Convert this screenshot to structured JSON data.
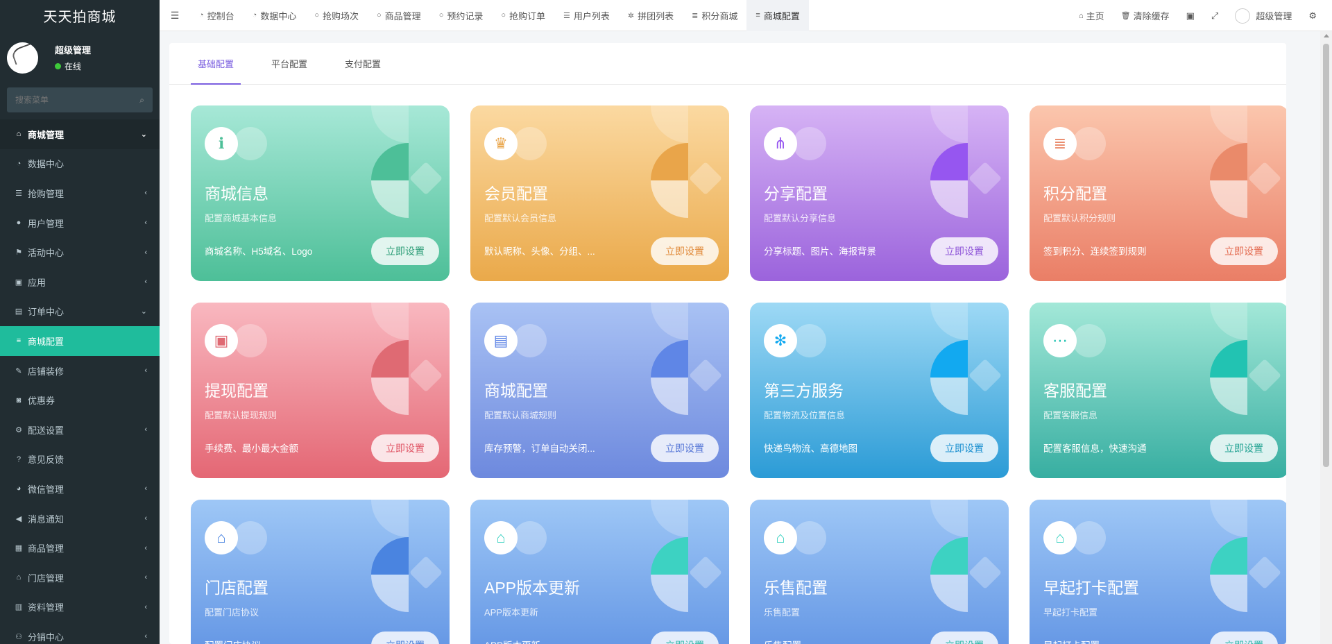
{
  "brand": "天天拍商城",
  "user": {
    "name": "超级管理",
    "status": "在线"
  },
  "search": {
    "placeholder": "搜索菜单",
    "icon": "search-icon"
  },
  "menu": [
    {
      "label": "商城管理",
      "icon": "home-icon",
      "glyph": "⌂",
      "arrow": "⌄",
      "kind": "header"
    },
    {
      "label": "数据中心",
      "icon": "dashboard-icon",
      "glyph": "◔",
      "arrow": ""
    },
    {
      "label": "抢购管理",
      "icon": "list-icon",
      "glyph": "☰",
      "arrow": "‹"
    },
    {
      "label": "用户管理",
      "icon": "user-icon",
      "glyph": "●",
      "arrow": "‹"
    },
    {
      "label": "活动中心",
      "icon": "flag-icon",
      "glyph": "⚑",
      "arrow": "‹"
    },
    {
      "label": "应用",
      "icon": "briefcase-icon",
      "glyph": "▣",
      "arrow": "‹"
    },
    {
      "label": "订单中心",
      "icon": "file-icon",
      "glyph": "▤",
      "arrow": "⌄"
    },
    {
      "label": "商城配置",
      "icon": "sliders-icon",
      "glyph": "≡",
      "arrow": "",
      "kind": "active"
    },
    {
      "label": "店铺装修",
      "icon": "brush-icon",
      "glyph": "✎",
      "arrow": "‹"
    },
    {
      "label": "优惠券",
      "icon": "ticket-icon",
      "glyph": "◙",
      "arrow": ""
    },
    {
      "label": "配送设置",
      "icon": "cogs-icon",
      "glyph": "⚙",
      "arrow": "‹"
    },
    {
      "label": "意见反馈",
      "icon": "question-icon",
      "glyph": "?",
      "arrow": ""
    },
    {
      "label": "微信管理",
      "icon": "wechat-icon",
      "glyph": "◕",
      "arrow": "‹"
    },
    {
      "label": "消息通知",
      "icon": "bullhorn-icon",
      "glyph": "◀",
      "arrow": "‹"
    },
    {
      "label": "商品管理",
      "icon": "product-icon",
      "glyph": "▦",
      "arrow": "‹"
    },
    {
      "label": "门店管理",
      "icon": "bank-icon",
      "glyph": "⌂",
      "arrow": "‹"
    },
    {
      "label": "资料管理",
      "icon": "book-icon",
      "glyph": "▥",
      "arrow": "‹"
    },
    {
      "label": "分销中心",
      "icon": "users-icon",
      "glyph": "⚇",
      "arrow": "‹"
    }
  ],
  "topnav": {
    "tabs": [
      {
        "label": "控制台",
        "icon": "dashboard-icon",
        "glyph": "◔"
      },
      {
        "label": "数据中心",
        "icon": "dashboard-icon",
        "glyph": "◔"
      },
      {
        "label": "抢购场次",
        "icon": "circle-icon",
        "glyph": "○"
      },
      {
        "label": "商品管理",
        "icon": "circle-icon",
        "glyph": "○"
      },
      {
        "label": "预约记录",
        "icon": "circle-icon",
        "glyph": "○"
      },
      {
        "label": "抢购订单",
        "icon": "circle-icon",
        "glyph": "○"
      },
      {
        "label": "用户列表",
        "icon": "list-icon",
        "glyph": "☰"
      },
      {
        "label": "拼团列表",
        "icon": "puzzle-icon",
        "glyph": "✲"
      },
      {
        "label": "积分商城",
        "icon": "database-icon",
        "glyph": "≣"
      },
      {
        "label": "商城配置",
        "icon": "sliders-icon",
        "glyph": "≡",
        "active": true
      }
    ],
    "right": {
      "home": "主页",
      "clear_cache": "清除缓存",
      "admin": "超级管理"
    }
  },
  "content_tabs": [
    {
      "label": "基础配置",
      "active": true
    },
    {
      "label": "平台配置"
    },
    {
      "label": "支付配置"
    }
  ],
  "button_label": "立即设置",
  "cards": [
    {
      "title": "商城信息",
      "desc": "配置商城基本信息",
      "feat": "商城名称、H5域名、Logo",
      "icon": "info-icon",
      "glyph": "ℹ",
      "from": "#a7e8d7",
      "to": "#4dbf98",
      "leaf": "#4dbf98",
      "btn_color": "#2f9e79"
    },
    {
      "title": "会员配置",
      "desc": "配置默认会员信息",
      "feat": "默认昵称、头像、分组、...",
      "icon": "crown-icon",
      "glyph": "♛",
      "from": "#fbd9a1",
      "to": "#eaa94a",
      "leaf": "#e9a54a",
      "btn_color": "#e08a3a"
    },
    {
      "title": "分享配置",
      "desc": "配置默认分享信息",
      "feat": "分享标题、图片、海报背景",
      "icon": "share-icon",
      "glyph": "⋔",
      "from": "#d6b3f5",
      "to": "#9b63dc",
      "leaf": "#9656f0",
      "btn_color": "#8e55d8"
    },
    {
      "title": "积分配置",
      "desc": "配置默认积分规则",
      "feat": "签到积分、连续签到规则",
      "icon": "database-icon",
      "glyph": "≣",
      "from": "#fbc6ad",
      "to": "#ea7e66",
      "leaf": "#ea8a6a",
      "btn_color": "#e36a50"
    },
    {
      "title": "提现配置",
      "desc": "配置默认提现规则",
      "feat": "手续费、最小最大金额",
      "icon": "wallet-icon",
      "glyph": "▣",
      "from": "#f9b8c0",
      "to": "#e46774",
      "leaf": "#df6a73",
      "btn_color": "#e05566"
    },
    {
      "title": "商城配置",
      "desc": "配置默认商城规则",
      "feat": "库存预警，订单自动关闭...",
      "icon": "clipboard-icon",
      "glyph": "▤",
      "from": "#a9c2f4",
      "to": "#6d89de",
      "leaf": "#5f86e6",
      "btn_color": "#5576d6"
    },
    {
      "title": "第三方服务",
      "desc": "配置物流及位置信息",
      "feat": "快递鸟物流、高德地图",
      "icon": "snowflake-icon",
      "glyph": "✻",
      "from": "#9ed9f5",
      "to": "#2b9bd6",
      "leaf": "#12a9f0",
      "btn_color": "#1a8fd0"
    },
    {
      "title": "客服配置",
      "desc": "配置客服信息",
      "feat": "配置客服信息，快速沟通",
      "icon": "chat-icon",
      "glyph": "⋯",
      "from": "#a3e8d8",
      "to": "#37aea1",
      "leaf": "#22c3b2",
      "btn_color": "#22a392"
    },
    {
      "title": "门店配置",
      "desc": "配置门店协议",
      "feat": "配置门店协议",
      "icon": "store-icon",
      "glyph": "⌂",
      "from": "#9ec7f6",
      "to": "#5b8fe2",
      "leaf": "#4a84e0",
      "btn_color": "#4a7fd8"
    },
    {
      "title": "APP版本更新",
      "desc": "APP版本更新",
      "feat": "APP版本更新",
      "icon": "store-icon",
      "glyph": "⌂",
      "from": "#9ec7f6",
      "to": "#5b8fe2",
      "leaf": "#3dd2c2",
      "btn_color": "#2fb8a8"
    },
    {
      "title": "乐售配置",
      "desc": "乐售配置",
      "feat": "乐售配置",
      "icon": "store-icon",
      "glyph": "⌂",
      "from": "#9ec7f6",
      "to": "#5b8fe2",
      "leaf": "#3dd2c2",
      "btn_color": "#2fb8a8"
    },
    {
      "title": "早起打卡配置",
      "desc": "早起打卡配置",
      "feat": "早起打卡配置",
      "icon": "store-icon",
      "glyph": "⌂",
      "from": "#9ec7f6",
      "to": "#5b8fe2",
      "leaf": "#3dd2c2",
      "btn_color": "#2fb8a8"
    }
  ]
}
